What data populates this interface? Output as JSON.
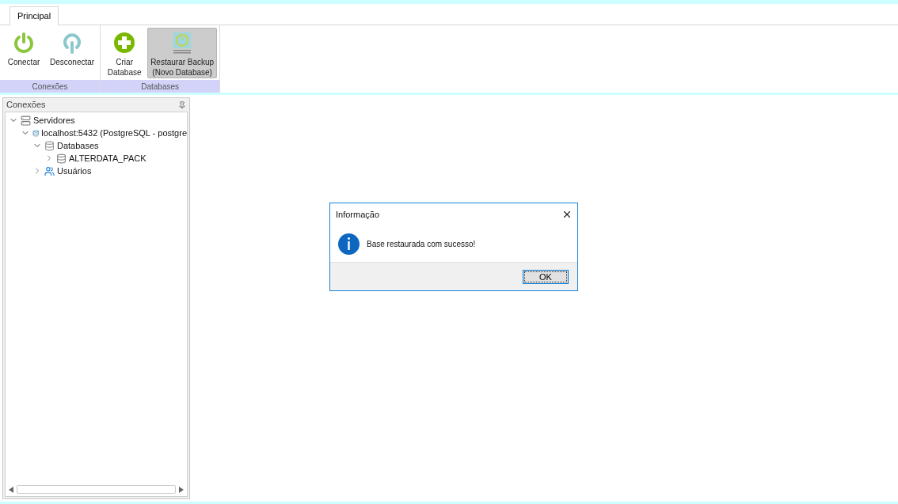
{
  "tabs": [
    {
      "label": "Principal",
      "selected": true
    }
  ],
  "ribbon": {
    "groups": [
      {
        "label": "Conexões",
        "buttons": [
          {
            "kind": "connect",
            "label": "Conectar",
            "selected": false
          },
          {
            "kind": "disconnect",
            "label": "Desconectar",
            "selected": false
          }
        ]
      },
      {
        "label": "Databases",
        "buttons": [
          {
            "kind": "create",
            "label": "Criar\nDatabase",
            "selected": false
          },
          {
            "kind": "restore",
            "label": "Restaurar Backup\n(Novo Database)",
            "selected": true
          }
        ]
      }
    ]
  },
  "panel": {
    "title": "Conexões",
    "tree": [
      {
        "kind": "servers",
        "label": "Servidores",
        "expanded": true,
        "children": [
          {
            "kind": "server",
            "label": "localhost:5432 (PostgreSQL - postgre",
            "expanded": true,
            "children": [
              {
                "kind": "databases",
                "label": "Databases",
                "expanded": true,
                "children": [
                  {
                    "kind": "database",
                    "label": "ALTERDATA_PACK",
                    "expanded": false
                  }
                ]
              },
              {
                "kind": "users",
                "label": "Usuários",
                "expanded": false
              }
            ]
          }
        ]
      }
    ]
  },
  "dialog": {
    "title": "Informação",
    "message": "Base restaurada com sucesso!",
    "button": "OK"
  }
}
